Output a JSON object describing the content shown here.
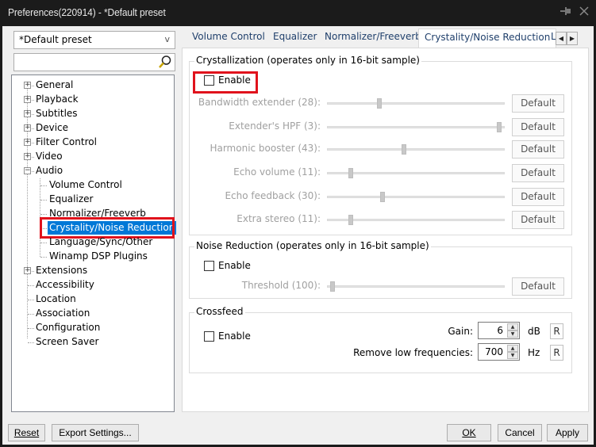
{
  "window": {
    "title": "Preferences(220914) - *Default preset",
    "pin_icon": "pin-icon",
    "close_icon": "close-icon"
  },
  "sidebar": {
    "preset_select": {
      "value": "*Default preset",
      "chevron": "v"
    },
    "search": {
      "value": "",
      "placeholder": "",
      "icon": "search-icon"
    },
    "tree": [
      {
        "label": "General",
        "level": 0,
        "expander": "+"
      },
      {
        "label": "Playback",
        "level": 0,
        "expander": "+"
      },
      {
        "label": "Subtitles",
        "level": 0,
        "expander": "+"
      },
      {
        "label": "Device",
        "level": 0,
        "expander": "+"
      },
      {
        "label": "Filter Control",
        "level": 0,
        "expander": "+"
      },
      {
        "label": "Video",
        "level": 0,
        "expander": "+"
      },
      {
        "label": "Audio",
        "level": 0,
        "expander": "-"
      },
      {
        "label": "Volume Control",
        "level": 1
      },
      {
        "label": "Equalizer",
        "level": 1
      },
      {
        "label": "Normalizer/Freeverb",
        "level": 1
      },
      {
        "label": "Crystality/Noise Reduction",
        "level": 1,
        "selected": true
      },
      {
        "label": "Language/Sync/Other",
        "level": 1
      },
      {
        "label": "Winamp DSP Plugins",
        "level": 1
      },
      {
        "label": "Extensions",
        "level": 0,
        "expander": "+"
      },
      {
        "label": "Accessibility",
        "level": 0
      },
      {
        "label": "Location",
        "level": 0
      },
      {
        "label": "Association",
        "level": 0
      },
      {
        "label": "Configuration",
        "level": 0
      },
      {
        "label": "Screen Saver",
        "level": 0
      }
    ]
  },
  "tabs": {
    "items": [
      "Volume Control",
      "Equalizer",
      "Normalizer/Freeverb",
      "Crystality/Noise Reduction",
      "L"
    ],
    "active": "Crystality/Noise Reduction",
    "scroll_left": "◀",
    "scroll_right": "▶"
  },
  "crystallization": {
    "title": "Crystallization (operates only in 16-bit sample)",
    "enable_label": "Enable",
    "enabled": false,
    "params": [
      {
        "label": "Bandwidth extender (28):",
        "value_fraction": 0.28,
        "button": "Default"
      },
      {
        "label": "Extender's HPF  (3):",
        "value_fraction": 1.0,
        "button": "Default"
      },
      {
        "label": "Harmonic booster (43):",
        "value_fraction": 0.43,
        "button": "Default"
      },
      {
        "label": "Echo volume (11):",
        "value_fraction": 0.11,
        "button": "Default"
      },
      {
        "label": "Echo feedback (30):",
        "value_fraction": 0.3,
        "button": "Default"
      },
      {
        "label": "Extra stereo (11):",
        "value_fraction": 0.11,
        "button": "Default"
      }
    ]
  },
  "noise_reduction": {
    "title": "Noise Reduction (operates only in 16-bit sample)",
    "enable_label": "Enable",
    "enabled": false,
    "params": [
      {
        "label": "Threshold (100):",
        "value_fraction": 0.0,
        "button": "Default"
      }
    ]
  },
  "crossfeed": {
    "title": "Crossfeed",
    "enable_label": "Enable",
    "enabled": false,
    "gain": {
      "label": "Gain:",
      "value": "6",
      "unit": "dB",
      "reset": "R"
    },
    "low_freq": {
      "label": "Remove low frequencies:",
      "value": "700",
      "unit": "Hz",
      "reset": "R"
    }
  },
  "footer": {
    "reset": "Reset",
    "export": "Export Settings...",
    "ok": "OK",
    "cancel": "Cancel",
    "apply": "Apply"
  },
  "annotation_color": "#e0121c",
  "selection_color": "#0078d7"
}
